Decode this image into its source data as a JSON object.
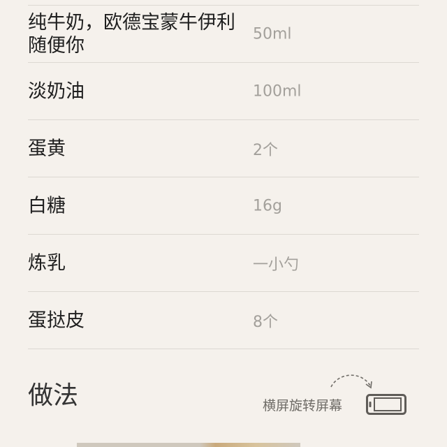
{
  "ingredients": [
    {
      "name": "纯牛奶，欧德宝蒙牛伊利随便你",
      "amount": "50ml"
    },
    {
      "name": "淡奶油",
      "amount": "100ml"
    },
    {
      "name": "蛋黄",
      "amount": "2个"
    },
    {
      "name": "白糖",
      "amount": "16g"
    },
    {
      "name": "炼乳",
      "amount": "一小勺"
    },
    {
      "name": "蛋挞皮",
      "amount": "8个"
    }
  ],
  "method": {
    "title": "做法",
    "rotate_label": "横屏旋转屏幕"
  },
  "icons": {
    "rotate": "rotate-screen-icon",
    "arrow": "curved-arrow-icon"
  },
  "colors": {
    "background": "#f5f1ec",
    "text": "#1f1f1f",
    "muted": "#a3a09b"
  }
}
